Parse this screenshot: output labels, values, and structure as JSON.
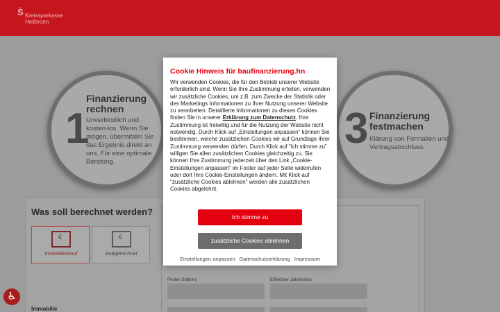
{
  "header": {
    "brand_line1": "Kreissparkasse",
    "brand_line2": "Heilbronn",
    "brand_icon": "sparkasse-s-icon",
    "color": "#c5161d"
  },
  "steps": [
    {
      "number": "1",
      "title": "Finanzierung rechnen",
      "text": "Unverbindlich und kosten-los. Wenn Sie mögen, übermitteln Sie das Ergebnis direkt an uns. Für eine optimale Beratung."
    },
    {
      "number": "3",
      "title": "Finanzierung festmachen",
      "text": "Klärung von Formalien und Vertragsabschluss."
    }
  ],
  "calculator": {
    "title": "Was soll berechnet werden?",
    "tiles": [
      {
        "label": "Immobilienkauf",
        "icon": "house-euro-icon"
      },
      {
        "label": "Budgetrechner",
        "icon": "house-euro-icon"
      }
    ],
    "section_label": "Immobilie",
    "field_labels": [
      "Fester Sollzins",
      "Effektiver Jahreszins"
    ]
  },
  "dialog": {
    "title": "Cookie Hinweis für baufinanzierung.hn",
    "body_part1": "Wir verwenden Cookies, die für den Betrieb unserer Website erforderlich sind. Wenn Sie Ihre Zustimmung erteilen, verwenden wir zusätzliche Cookies, um z.B. zum Zwecke der Statistik oder des Marketings Informationen zu Ihrer Nutzung unserer Website zu verarbeiten. Detaillierte Informationen zu diesen Cookies finden Sie in unserer ",
    "body_link": "Erklärung zum Datenschutz",
    "body_part2": ". Ihre Zustimmung ist freiwillig und für die Nutzung der Website nicht notwendig. Durch Klick auf „Einstellungen anpassen“ können Sie bestimmen, welche zusätzlichen Cookies wir auf Grundlage Ihrer Zustimmung verwenden dürfen. Durch Klick auf \"Ich stimme zu\" willigen Sie allen zusätzlichen Cookies gleichzeitig zu. Sie können Ihre Zustimmung jederzeit über den Link „Cookie-Einstellungen anpassen“ im Footer auf jeder Seite widerrufen oder dort Ihre Cookie-Einstellungen ändern. Mit Klick auf \"zusätzliche Cookies ablehnen\" werden alle zusätzlichen Cookies abgelehnt.",
    "accept_label": "Ich stimme zu",
    "reject_label": "zusätzliche Cookies ablehnen",
    "links": [
      "Einstellungen anpassen",
      "Datenschutzerklärung",
      "Impressum"
    ],
    "accent_color": "#e3000f"
  },
  "help_icon": "accessibility-icon"
}
